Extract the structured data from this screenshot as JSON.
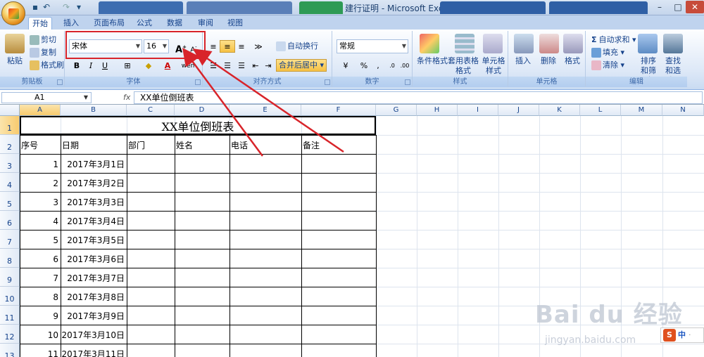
{
  "window": {
    "title": "建行证明 - Microsoft Excel"
  },
  "tabs": [
    "开始",
    "插入",
    "页面布局",
    "公式",
    "数据",
    "审阅",
    "视图"
  ],
  "ribbon": {
    "clipboard": {
      "paste": "粘贴",
      "cut": "剪切",
      "copy": "复制",
      "format_painter": "格式刷",
      "label": "剪贴板"
    },
    "font": {
      "name": "宋体",
      "size": "16",
      "grow": "A",
      "shrink": "A",
      "bold": "B",
      "italic": "I",
      "underline": "U",
      "fontcolor_letter": "A",
      "wen": "wén",
      "label": "字体"
    },
    "alignment": {
      "wrap": "自动换行",
      "merge": "合并后居中",
      "label": "对齐方式"
    },
    "number": {
      "format": "常规",
      "percent": "%",
      "comma": ",",
      "label": "数字"
    },
    "styles": {
      "conditional": "条件格式",
      "table_format": "套用表格格式",
      "cell_styles": "单元格样式",
      "label": "样式"
    },
    "cells": {
      "insert": "插入",
      "delete": "删除",
      "format": "格式",
      "label": "单元格"
    },
    "editing": {
      "autosum": "自动求和",
      "fill": "填充",
      "clear": "清除",
      "sort": "排序和筛选",
      "find": "查找和选择",
      "label": "编辑"
    }
  },
  "formula_bar": {
    "name_box": "A1",
    "fx": "fx",
    "content": "XX单位倒班表"
  },
  "columns": [
    "A",
    "B",
    "C",
    "D",
    "E",
    "F",
    "G",
    "H",
    "I",
    "J",
    "K",
    "L",
    "M",
    "N"
  ],
  "rows": [
    "1",
    "2",
    "3",
    "4",
    "5",
    "6",
    "7",
    "8",
    "9",
    "10",
    "11",
    "12",
    "13"
  ],
  "sheet": {
    "title": "XX单位倒班表",
    "headers": [
      "序号",
      "日期",
      "部门",
      "姓名",
      "电话",
      "备注"
    ],
    "data": [
      [
        "1",
        "2017年3月1日"
      ],
      [
        "2",
        "2017年3月2日"
      ],
      [
        "3",
        "2017年3月3日"
      ],
      [
        "4",
        "2017年3月4日"
      ],
      [
        "5",
        "2017年3月5日"
      ],
      [
        "6",
        "2017年3月6日"
      ],
      [
        "7",
        "2017年3月7日"
      ],
      [
        "8",
        "2017年3月8日"
      ],
      [
        "9",
        "2017年3月9日"
      ],
      [
        "10",
        "2017年3月10日"
      ],
      [
        "11",
        "2017年3月11日"
      ]
    ]
  },
  "watermark": {
    "logo": "Bai du 经验",
    "url": "jingyan.baidu.com"
  },
  "ime": {
    "s": "S",
    "zh": "中"
  },
  "colors": {
    "annotation": "#d8242a",
    "ribbon_text": "#15428b"
  }
}
